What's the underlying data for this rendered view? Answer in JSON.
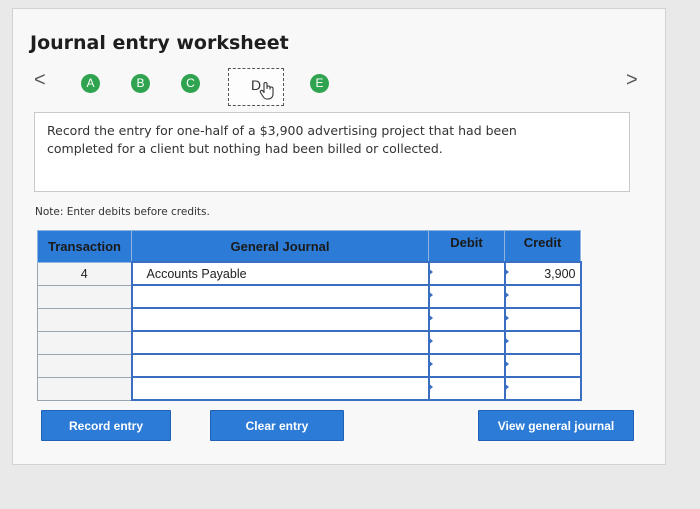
{
  "title": "Journal entry worksheet",
  "nav": {
    "prev": "<",
    "next": ">",
    "steps": [
      "A",
      "B",
      "C",
      "D",
      "E"
    ],
    "active_step": "D"
  },
  "description": "Record the entry for one-half of a $3,900 advertising project that had been completed for a client but nothing had been billed or collected.",
  "note": "Note: Enter debits before credits.",
  "journal": {
    "headers": {
      "transaction": "Transaction",
      "general_journal": "General Journal",
      "debit": "Debit",
      "credit": "Credit"
    },
    "rows": [
      {
        "transaction": "4",
        "account": "Accounts Payable",
        "debit": "",
        "credit": "3,900"
      },
      {
        "transaction": "",
        "account": "",
        "debit": "",
        "credit": ""
      },
      {
        "transaction": "",
        "account": "",
        "debit": "",
        "credit": ""
      },
      {
        "transaction": "",
        "account": "",
        "debit": "",
        "credit": ""
      },
      {
        "transaction": "",
        "account": "",
        "debit": "",
        "credit": ""
      },
      {
        "transaction": "",
        "account": "",
        "debit": "",
        "credit": ""
      }
    ]
  },
  "buttons": {
    "record": "Record entry",
    "clear": "Clear entry",
    "view": "View general journal"
  },
  "colors": {
    "accent": "#2c7bd6",
    "step_green": "#2fa34f"
  }
}
